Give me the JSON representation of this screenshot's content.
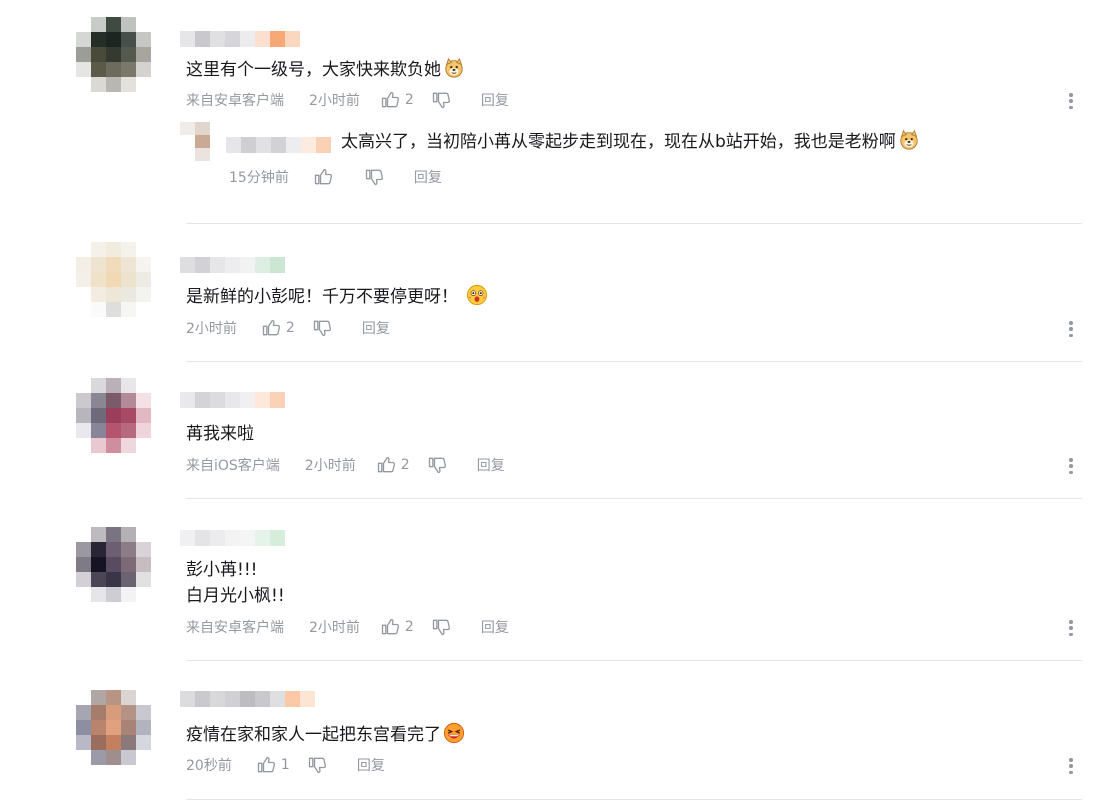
{
  "icons": {
    "like": "thumb-up-icon",
    "dislike": "thumb-down-icon",
    "more": "more-vertical-icon",
    "emoji_doge": "doge-emoji-icon",
    "emoji_surprise": "surprised-emoji-icon",
    "emoji_laugh": "laughing-emoji-icon"
  },
  "colors": {
    "meta_text": "#9499a0",
    "divider": "#e3e5e7",
    "body_text": "#18191c"
  },
  "comments": [
    {
      "text": "这里有个一级号，大家快来欺负她",
      "source": "来自安卓客户端",
      "time": "2小时前",
      "likes": "2",
      "reply_label": "回复",
      "sub_reply": {
        "text": "太高兴了，当初陪小苒从零起步走到现在，现在从b站开始，我也是老粉啊",
        "time": "15分钟前",
        "likes": "",
        "reply_label": "回复"
      }
    },
    {
      "text": "是新鲜的小彭呢！千万不要停更呀！",
      "source": "",
      "time": "2小时前",
      "likes": "2",
      "reply_label": "回复"
    },
    {
      "text": "苒我来啦",
      "source": "来自iOS客户端",
      "time": "2小时前",
      "likes": "2",
      "reply_label": "回复"
    },
    {
      "text_line1": "彭小苒!!!",
      "text_line2": "白月光小枫!!",
      "source": "来自安卓客户端",
      "time": "2小时前",
      "likes": "2",
      "reply_label": "回复"
    },
    {
      "text": "疫情在家和家人一起把东宫看完了",
      "source": "",
      "time": "20秒前",
      "likes": "1",
      "reply_label": "回复"
    }
  ]
}
